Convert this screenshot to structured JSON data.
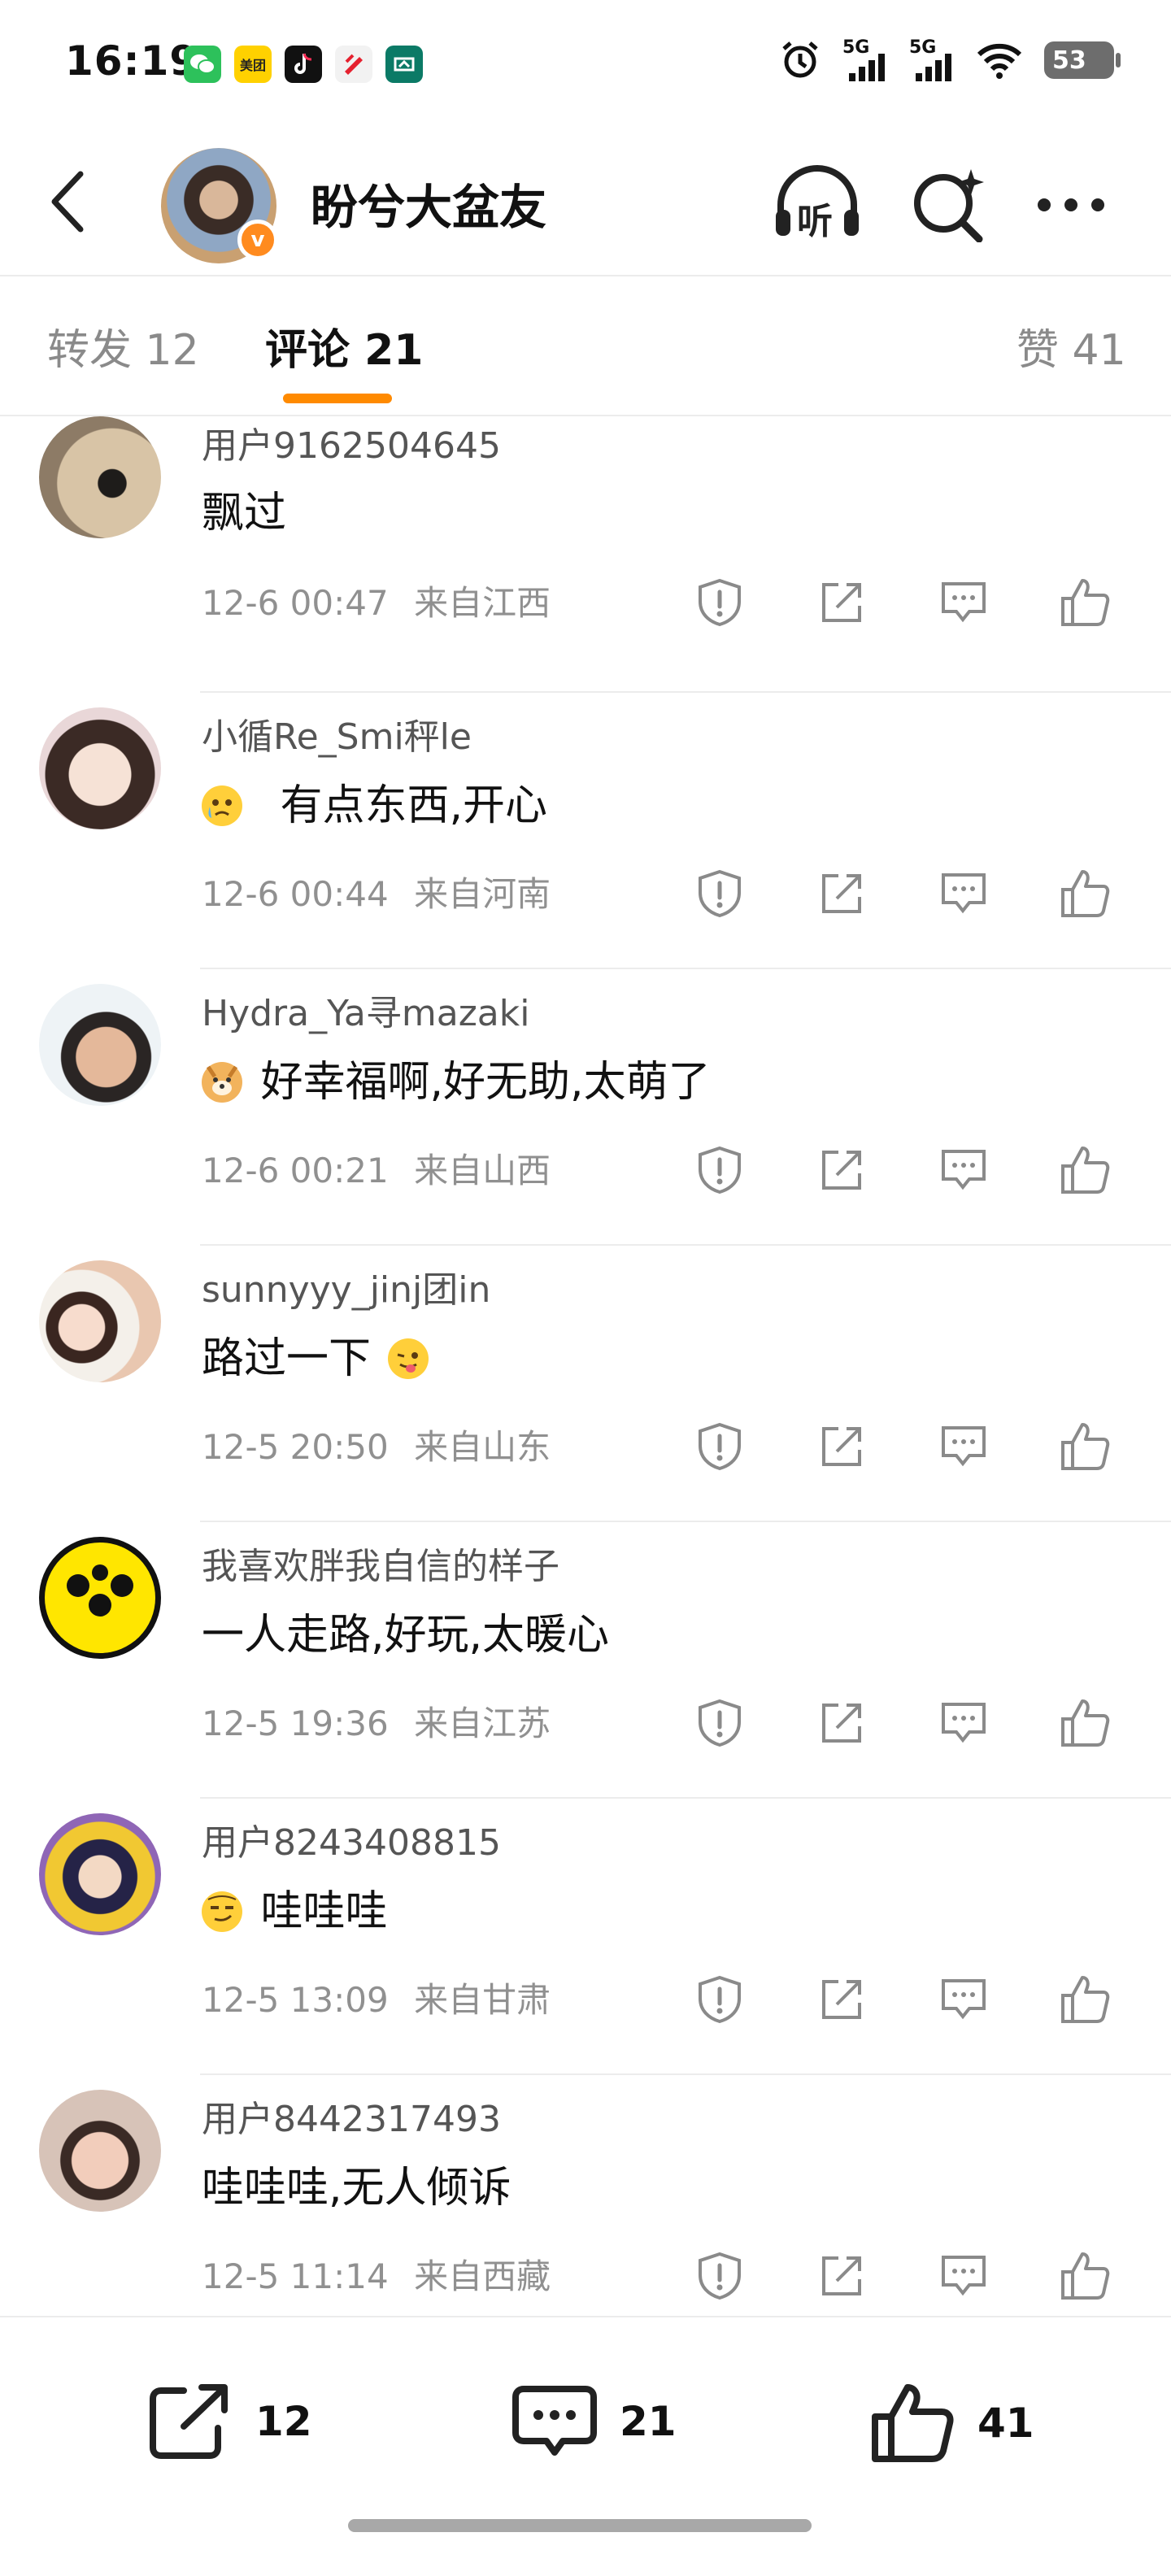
{
  "status_bar": {
    "time": "16:19",
    "signal_1": "5G",
    "signal_2": "5G",
    "battery": "53",
    "app_icons": [
      "wechat-icon",
      "meituan-icon",
      "tiktok-icon",
      "red-app-icon",
      "green-app-icon"
    ],
    "meituan_label": "美团"
  },
  "header": {
    "title": "盼兮大盆友",
    "listen_label": "听",
    "verified_mark": "v"
  },
  "tabs": {
    "repost": "转发 12",
    "comments": "评论 21",
    "likes": "赞 41"
  },
  "comments": [
    {
      "name": "用户9162504645",
      "text": "飘过",
      "time": "12-6 00:47",
      "location": "来自江西"
    },
    {
      "name": "小循Re_Smi秤le",
      "text": "有点东西,开心",
      "time": "12-6 00:44",
      "location": "来自河南"
    },
    {
      "name": "Hydra_Ya寻mazaki",
      "text": "好幸福啊,好无助,太萌了",
      "time": "12-6 00:21",
      "location": "来自山西"
    },
    {
      "name": "sunnyyy_jinj团in",
      "text": "路过一下",
      "time": "12-5 20:50",
      "location": "来自山东"
    },
    {
      "name": "我喜欢胖我自信的样子",
      "text": "一人走路,好玩,太暖心",
      "time": "12-5 19:36",
      "location": "来自江苏"
    },
    {
      "name": "用户8243408815",
      "text": "哇哇哇",
      "time": "12-5 13:09",
      "location": "来自甘肃"
    },
    {
      "name": "用户8442317493",
      "text": "哇哇哇,无人倾诉",
      "time": "12-5 11:14",
      "location": "来自西藏"
    }
  ],
  "bottom_bar": {
    "repost_count": "12",
    "comment_count": "21",
    "like_count": "41"
  },
  "colors": {
    "accent": "#ff8a00",
    "text_primary": "#111111",
    "text_secondary": "#909090",
    "icon": "#8a8a8a"
  }
}
